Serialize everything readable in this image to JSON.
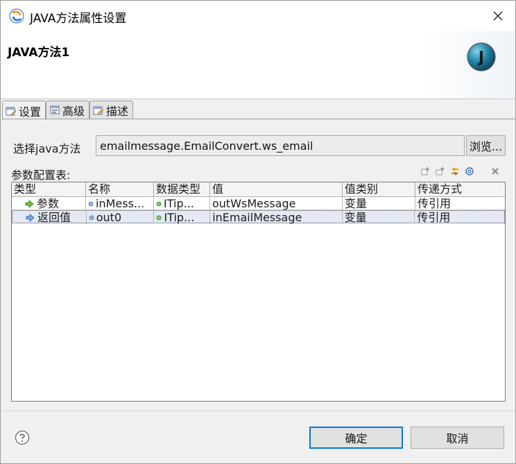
{
  "window": {
    "title": "JAVA方法属性设置",
    "close_icon": "close-icon"
  },
  "banner": {
    "title": "JAVA方法1",
    "logo_letter": "J"
  },
  "tabs": [
    {
      "label": "设置",
      "icon": "settings-tab-icon",
      "active": true
    },
    {
      "label": "高级",
      "icon": "advanced-tab-icon",
      "active": false
    },
    {
      "label": "描述",
      "icon": "description-tab-icon",
      "active": false
    }
  ],
  "form": {
    "method_label": "选择java方法",
    "method_value": "emailmessage.EmailConvert.ws_email",
    "browse_label": "浏览..."
  },
  "params": {
    "label": "参数配置表:",
    "columns": [
      "类型",
      "名称",
      "数据类型",
      "值",
      "值类别",
      "传递方式"
    ],
    "rows": [
      {
        "type": "参数",
        "name": "inMess...",
        "datatype": "ITip...",
        "value": "outWsMessage",
        "value_kind": "变量",
        "pass_mode": "传引用"
      },
      {
        "type": "返回值",
        "name": "out0",
        "datatype": "ITip...",
        "value": "inEmailMessage",
        "value_kind": "变量",
        "pass_mode": "传引用"
      }
    ]
  },
  "buttons": {
    "ok": "确定",
    "cancel": "取消"
  },
  "colors": {
    "primary_border": "#0078d7",
    "selection": "#e4e9f3"
  }
}
